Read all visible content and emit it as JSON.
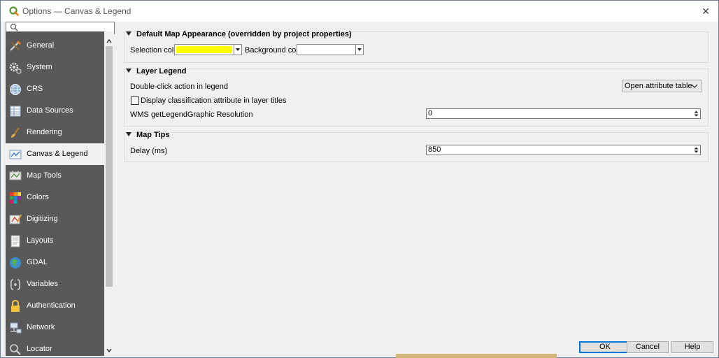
{
  "window": {
    "title": "Options — Canvas & Legend",
    "close_glyph": "✕"
  },
  "search": {
    "placeholder": ""
  },
  "sidebar": {
    "items": [
      {
        "label": "General",
        "icon": "wrench-hammer-icon"
      },
      {
        "label": "System",
        "icon": "gear-icon"
      },
      {
        "label": "CRS",
        "icon": "globe-icon"
      },
      {
        "label": "Data Sources",
        "icon": "table-icon"
      },
      {
        "label": "Rendering",
        "icon": "paintbrush-icon"
      },
      {
        "label": "Canvas & Legend",
        "icon": "map-canvas-icon"
      },
      {
        "label": "Map Tools",
        "icon": "map-tools-icon"
      },
      {
        "label": "Colors",
        "icon": "color-palette-icon"
      },
      {
        "label": "Digitizing",
        "icon": "digitizing-icon"
      },
      {
        "label": "Layouts",
        "icon": "layouts-icon"
      },
      {
        "label": "GDAL",
        "icon": "gdal-icon"
      },
      {
        "label": "Variables",
        "icon": "variables-icon"
      },
      {
        "label": "Authentication",
        "icon": "lock-icon"
      },
      {
        "label": "Network",
        "icon": "network-icon"
      },
      {
        "label": "Locator",
        "icon": "search-icon"
      }
    ],
    "selected": "Canvas & Legend"
  },
  "groups": {
    "default_map_appearance": {
      "title": "Default Map Appearance (overridden by project properties)",
      "selection_color_label": "Selection color",
      "selection_color": "#ffff00",
      "background_color_label": "Background color",
      "background_color": "#ffffff"
    },
    "layer_legend": {
      "title": "Layer Legend",
      "double_click_label": "Double-click action in legend",
      "double_click_value": "Open attribute table",
      "display_classification_label": "Display classification attribute in layer titles",
      "display_classification_checked": false,
      "wms_resolution_label": "WMS getLegendGraphic Resolution",
      "wms_resolution_value": "0"
    },
    "map_tips": {
      "title": "Map Tips",
      "delay_label": "Delay (ms)",
      "delay_value": "850"
    }
  },
  "buttons": {
    "ok": "OK",
    "cancel": "Cancel",
    "help": "Help"
  },
  "colors": {
    "sidebar_bg": "#595959",
    "selected_bg": "#f0f0f0",
    "accent": "#0078d7"
  }
}
